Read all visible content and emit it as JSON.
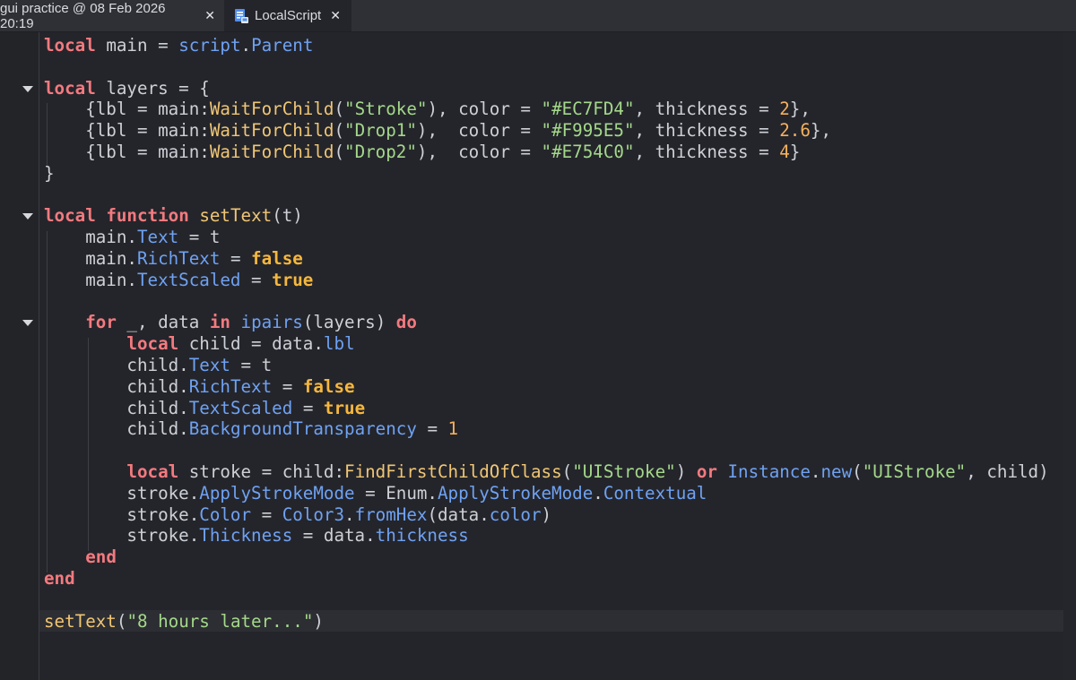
{
  "tabs": [
    {
      "label": "gui practice @ 08 Feb 2026 20:19",
      "close": "✕"
    },
    {
      "label": "LocalScript",
      "close": "✕",
      "icon": "localscript-icon"
    }
  ],
  "colors": {
    "background": "#24252b",
    "keyword": "#f37a7f",
    "boolean": "#f5b73d",
    "string": "#a4d88a",
    "number": "#f5b15d",
    "property": "#6fa2f2",
    "method": "#f0c674",
    "text": "#cdd0d6"
  },
  "code": [
    [
      [
        "kw",
        "local"
      ],
      [
        "id",
        " main = "
      ],
      [
        "glob",
        "script"
      ],
      [
        "id",
        "."
      ],
      [
        "prop",
        "Parent"
      ]
    ],
    [],
    [
      [
        "kw",
        "local"
      ],
      [
        "id",
        " layers = {"
      ]
    ],
    [
      [
        "id",
        "    {lbl = main:"
      ],
      [
        "fn",
        "WaitForChild"
      ],
      [
        "id",
        "("
      ],
      [
        "str",
        "\"Stroke\""
      ],
      [
        "id",
        "), color = "
      ],
      [
        "str",
        "\"#EC7FD4\""
      ],
      [
        "id",
        ", thickness = "
      ],
      [
        "num",
        "2"
      ],
      [
        "id",
        "},"
      ]
    ],
    [
      [
        "id",
        "    {lbl = main:"
      ],
      [
        "fn",
        "WaitForChild"
      ],
      [
        "id",
        "("
      ],
      [
        "str",
        "\"Drop1\""
      ],
      [
        "id",
        "),  color = "
      ],
      [
        "str",
        "\"#F995E5\""
      ],
      [
        "id",
        ", thickness = "
      ],
      [
        "num",
        "2.6"
      ],
      [
        "id",
        "},"
      ]
    ],
    [
      [
        "id",
        "    {lbl = main:"
      ],
      [
        "fn",
        "WaitForChild"
      ],
      [
        "id",
        "("
      ],
      [
        "str",
        "\"Drop2\""
      ],
      [
        "id",
        "),  color = "
      ],
      [
        "str",
        "\"#E754C0\""
      ],
      [
        "id",
        ", thickness = "
      ],
      [
        "num",
        "4"
      ],
      [
        "id",
        "}"
      ]
    ],
    [
      [
        "id",
        "}"
      ]
    ],
    [],
    [
      [
        "kw",
        "local"
      ],
      [
        "id",
        " "
      ],
      [
        "kw",
        "function"
      ],
      [
        "id",
        " "
      ],
      [
        "fname",
        "setText"
      ],
      [
        "id",
        "(t)"
      ]
    ],
    [
      [
        "id",
        "    main."
      ],
      [
        "prop",
        "Text"
      ],
      [
        "id",
        " = t"
      ]
    ],
    [
      [
        "id",
        "    main."
      ],
      [
        "prop",
        "RichText"
      ],
      [
        "id",
        " = "
      ],
      [
        "bool",
        "false"
      ]
    ],
    [
      [
        "id",
        "    main."
      ],
      [
        "prop",
        "TextScaled"
      ],
      [
        "id",
        " = "
      ],
      [
        "bool",
        "true"
      ]
    ],
    [],
    [
      [
        "id",
        "    "
      ],
      [
        "kw",
        "for"
      ],
      [
        "id",
        " _, data "
      ],
      [
        "kw",
        "in"
      ],
      [
        "id",
        " "
      ],
      [
        "glob",
        "ipairs"
      ],
      [
        "id",
        "(layers) "
      ],
      [
        "kw",
        "do"
      ]
    ],
    [
      [
        "id",
        "        "
      ],
      [
        "kw",
        "local"
      ],
      [
        "id",
        " child = data."
      ],
      [
        "prop",
        "lbl"
      ]
    ],
    [
      [
        "id",
        "        child."
      ],
      [
        "prop",
        "Text"
      ],
      [
        "id",
        " = t"
      ]
    ],
    [
      [
        "id",
        "        child."
      ],
      [
        "prop",
        "RichText"
      ],
      [
        "id",
        " = "
      ],
      [
        "bool",
        "false"
      ]
    ],
    [
      [
        "id",
        "        child."
      ],
      [
        "prop",
        "TextScaled"
      ],
      [
        "id",
        " = "
      ],
      [
        "bool",
        "true"
      ]
    ],
    [
      [
        "id",
        "        child."
      ],
      [
        "prop",
        "BackgroundTransparency"
      ],
      [
        "id",
        " = "
      ],
      [
        "num",
        "1"
      ]
    ],
    [],
    [
      [
        "id",
        "        "
      ],
      [
        "kw",
        "local"
      ],
      [
        "id",
        " stroke = child:"
      ],
      [
        "fn",
        "FindFirstChildOfClass"
      ],
      [
        "id",
        "("
      ],
      [
        "str",
        "\"UIStroke\""
      ],
      [
        "id",
        ") "
      ],
      [
        "kw",
        "or"
      ],
      [
        "id",
        " "
      ],
      [
        "glob",
        "Instance"
      ],
      [
        "id",
        "."
      ],
      [
        "glob",
        "new"
      ],
      [
        "id",
        "("
      ],
      [
        "str",
        "\"UIStroke\""
      ],
      [
        "id",
        ", child)"
      ]
    ],
    [
      [
        "id",
        "        stroke."
      ],
      [
        "prop",
        "ApplyStrokeMode"
      ],
      [
        "id",
        " = "
      ],
      [
        "id",
        "Enum."
      ],
      [
        "prop",
        "ApplyStrokeMode"
      ],
      [
        "id",
        "."
      ],
      [
        "prop",
        "Contextual"
      ]
    ],
    [
      [
        "id",
        "        stroke."
      ],
      [
        "prop",
        "Color"
      ],
      [
        "id",
        " = "
      ],
      [
        "glob",
        "Color3"
      ],
      [
        "id",
        "."
      ],
      [
        "glob",
        "fromHex"
      ],
      [
        "id",
        "(data."
      ],
      [
        "prop",
        "color"
      ],
      [
        "id",
        ")"
      ]
    ],
    [
      [
        "id",
        "        stroke."
      ],
      [
        "prop",
        "Thickness"
      ],
      [
        "id",
        " = data."
      ],
      [
        "prop",
        "thickness"
      ]
    ],
    [
      [
        "id",
        "    "
      ],
      [
        "kw",
        "end"
      ]
    ],
    [
      [
        "kw",
        "end"
      ]
    ],
    [],
    [
      [
        "fname",
        "setText"
      ],
      [
        "id",
        "("
      ],
      [
        "str",
        "\"8 hours later...\""
      ],
      [
        "id",
        ")"
      ]
    ]
  ]
}
